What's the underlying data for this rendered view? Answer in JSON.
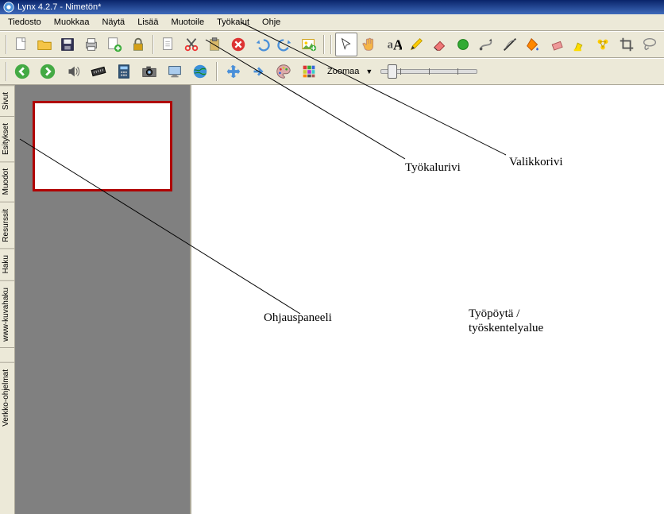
{
  "title": "Lynx 4.2.7 - Nimetön*",
  "menu": [
    "Tiedosto",
    "Muokkaa",
    "Näytä",
    "Lisää",
    "Muotoile",
    "Työkalut",
    "Ohje"
  ],
  "zoom_label": "Zoomaa",
  "side_tabs": [
    "Sivut",
    "Esitykset",
    "Muodot",
    "Resurssit",
    "Haku",
    "www-kuvahaku",
    "Verkko-ohjelmat"
  ],
  "annotations": {
    "valikkorivi": "Valikkorivi",
    "tyokalurivi": "Työkalurivi",
    "ohjauspaneeli": "Ohjauspaneeli",
    "tyopoyda_line1": "Työpöytä /",
    "tyopoyda_line2": "työskentelyalue"
  },
  "toolbar1_icons": [
    "new-file",
    "open-folder",
    "save",
    "print",
    "add-page",
    "lock",
    "sep",
    "cut",
    "copy",
    "paste",
    "delete",
    "undo",
    "redo",
    "insert-image",
    "sep",
    "select",
    "hand",
    "text",
    "pen",
    "eraser",
    "shape",
    "connector",
    "fill",
    "line",
    "highlight",
    "group",
    "crop",
    "lasso"
  ],
  "toolbar2_icons": [
    "nav-back",
    "nav-forward",
    "audio",
    "ruler",
    "calculator",
    "camera",
    "screen",
    "globe",
    "move",
    "arrow-right",
    "palette",
    "grid"
  ],
  "colors": {
    "title_bg": "#0a246a",
    "panel_bg": "#808080",
    "thumb_border": "#b00000",
    "ui_bg": "#ece9d8"
  }
}
